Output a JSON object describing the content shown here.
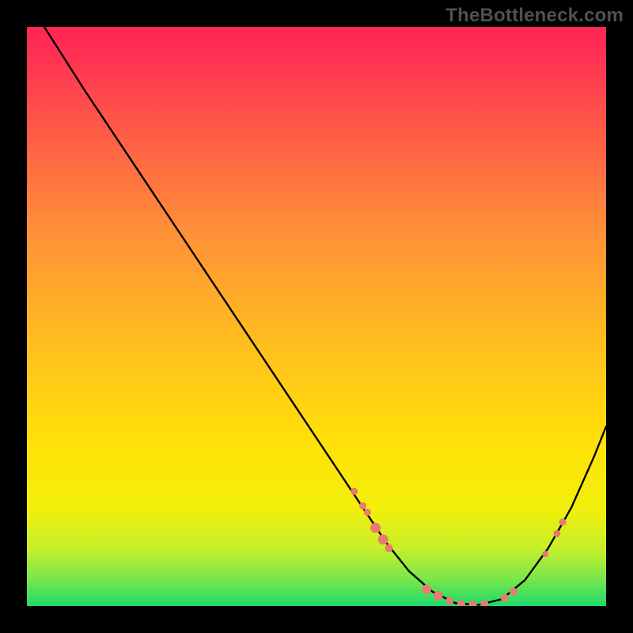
{
  "watermark_text": "TheBottleneck.com",
  "chart_data": {
    "type": "line",
    "title": "",
    "xlabel": "",
    "ylabel": "",
    "xlim": [
      0,
      100
    ],
    "ylim": [
      0,
      100
    ],
    "curve": {
      "name": "bottleneck-curve",
      "x": [
        3,
        10,
        20,
        30,
        40,
        48,
        54,
        58,
        62,
        66,
        70,
        74,
        78,
        82,
        86,
        90,
        94,
        98,
        100
      ],
      "y": [
        100,
        89,
        74,
        59,
        44,
        32,
        23,
        17,
        11,
        6,
        2.5,
        0.5,
        0.2,
        1.2,
        4.5,
        10,
        17,
        26,
        31
      ]
    },
    "markers": {
      "name": "highlight-dots",
      "color": "#e87a72",
      "points": [
        {
          "x": 56.5,
          "y": 19.8,
          "r": 4.5
        },
        {
          "x": 58.0,
          "y": 17.3,
          "r": 4.5
        },
        {
          "x": 58.8,
          "y": 16.2,
          "r": 4.5
        },
        {
          "x": 60.2,
          "y": 13.5,
          "r": 6.5
        },
        {
          "x": 61.5,
          "y": 11.5,
          "r": 6.5
        },
        {
          "x": 62.5,
          "y": 10.0,
          "r": 5.0
        },
        {
          "x": 69.0,
          "y": 2.9,
          "r": 6.0
        },
        {
          "x": 71.0,
          "y": 1.8,
          "r": 6.0
        },
        {
          "x": 73.0,
          "y": 0.9,
          "r": 5.0
        },
        {
          "x": 75.0,
          "y": 0.4,
          "r": 5.0
        },
        {
          "x": 77.0,
          "y": 0.3,
          "r": 5.0
        },
        {
          "x": 79.0,
          "y": 0.4,
          "r": 5.0
        },
        {
          "x": 82.5,
          "y": 1.4,
          "r": 5.0
        },
        {
          "x": 84.0,
          "y": 2.5,
          "r": 5.0
        },
        {
          "x": 89.5,
          "y": 9.0,
          "r": 4.0
        },
        {
          "x": 91.5,
          "y": 12.5,
          "r": 4.5
        },
        {
          "x": 92.5,
          "y": 14.5,
          "r": 4.5
        }
      ]
    },
    "background_gradient": {
      "top_color": "#ff2655",
      "mid_color": "#ffd400",
      "bottom_color": "#1bdb6a"
    }
  }
}
